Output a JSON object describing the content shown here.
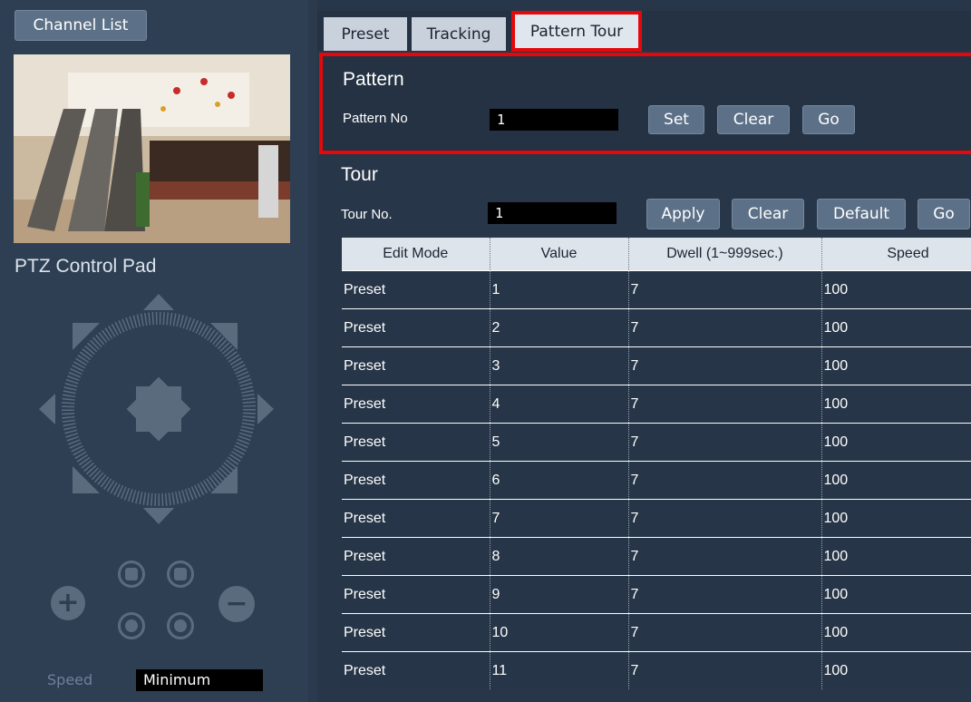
{
  "left": {
    "channel_list_label": "Channel List",
    "ptz_title": "PTZ Control Pad",
    "speed_label": "Speed",
    "speed_value": "Minimum"
  },
  "tabs": [
    {
      "label": "Preset"
    },
    {
      "label": "Tracking"
    },
    {
      "label": "Pattern Tour",
      "active": true
    }
  ],
  "pattern": {
    "title": "Pattern",
    "field_label": "Pattern No",
    "value": "1",
    "buttons": {
      "set": "Set",
      "clear": "Clear",
      "go": "Go"
    }
  },
  "tour": {
    "title": "Tour",
    "field_label": "Tour No.",
    "value": "1",
    "buttons": {
      "apply": "Apply",
      "clear": "Clear",
      "default": "Default",
      "go": "Go"
    },
    "columns": [
      "Edit Mode",
      "Value",
      "Dwell (1~999sec.)",
      "Speed"
    ],
    "rows": [
      [
        "Preset",
        "1",
        "7",
        "100"
      ],
      [
        "Preset",
        "2",
        "7",
        "100"
      ],
      [
        "Preset",
        "3",
        "7",
        "100"
      ],
      [
        "Preset",
        "4",
        "7",
        "100"
      ],
      [
        "Preset",
        "5",
        "7",
        "100"
      ],
      [
        "Preset",
        "6",
        "7",
        "100"
      ],
      [
        "Preset",
        "7",
        "7",
        "100"
      ],
      [
        "Preset",
        "8",
        "7",
        "100"
      ],
      [
        "Preset",
        "9",
        "7",
        "100"
      ],
      [
        "Preset",
        "10",
        "7",
        "100"
      ],
      [
        "Preset",
        "11",
        "7",
        "100"
      ]
    ]
  },
  "colors": {
    "highlight": "#e3080c",
    "panel": "#273648",
    "button": "#5c7087"
  }
}
